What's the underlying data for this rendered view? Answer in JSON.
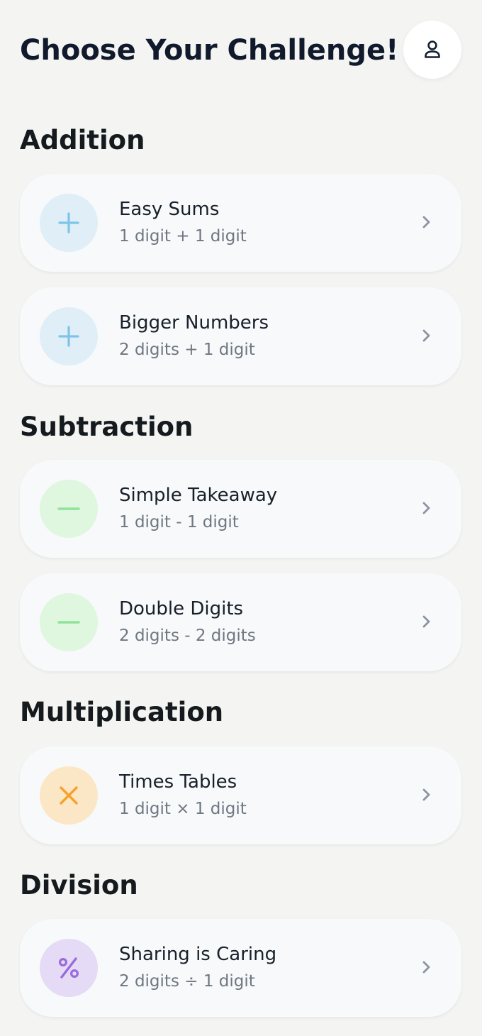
{
  "header": {
    "title": "Choose Your Challenge!",
    "profile_icon": "user-icon"
  },
  "colors": {
    "addition_bg": "#dfeef7",
    "addition_icon": "#7ec4ea",
    "subtraction_bg": "#dff6df",
    "subtraction_icon": "#8fe39a",
    "multiplication_bg": "#fbe7c6",
    "multiplication_icon": "#f8a12a",
    "division_bg": "#e5dbf6",
    "division_icon": "#9a6bdb",
    "chevron": "#8a94a3"
  },
  "sections": [
    {
      "title": "Addition",
      "items": [
        {
          "title": "Easy Sums",
          "subtitle": "1 digit + 1 digit",
          "icon": "plus-icon"
        },
        {
          "title": "Bigger Numbers",
          "subtitle": "2 digits + 1 digit",
          "icon": "plus-icon"
        }
      ]
    },
    {
      "title": "Subtraction",
      "items": [
        {
          "title": "Simple Takeaway",
          "subtitle": "1 digit - 1 digit",
          "icon": "minus-icon"
        },
        {
          "title": "Double Digits",
          "subtitle": "2 digits - 2 digits",
          "icon": "minus-icon"
        }
      ]
    },
    {
      "title": "Multiplication",
      "items": [
        {
          "title": "Times Tables",
          "subtitle": "1 digit × 1 digit",
          "icon": "times-icon"
        }
      ]
    },
    {
      "title": "Division",
      "items": [
        {
          "title": "Sharing is Caring",
          "subtitle": "2 digits ÷ 1 digit",
          "icon": "percent-icon"
        }
      ]
    }
  ]
}
